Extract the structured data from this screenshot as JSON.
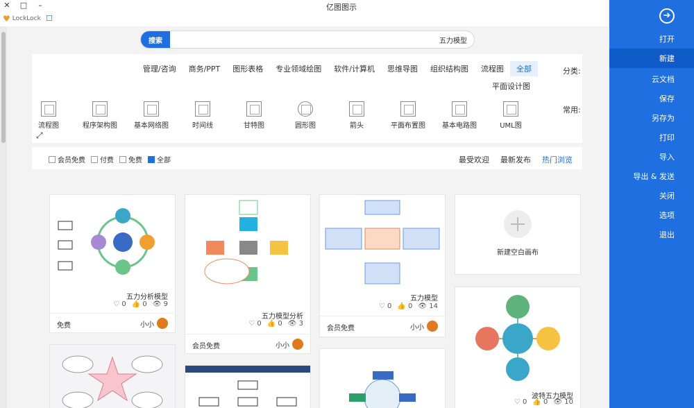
{
  "window": {
    "title": "亿图图示",
    "close": "✕",
    "max": "□",
    "min": "–"
  },
  "topbar": {
    "lock_text": "LockLock",
    "heart": "♥",
    "msg": "☐"
  },
  "search": {
    "button": "搜索",
    "value": "五力模型"
  },
  "categories": {
    "label": "分类:",
    "items": [
      "全部",
      "流程图",
      "组织结构图",
      "思维导图",
      "软件/计算机",
      "专业领域绘图",
      "图形表格",
      "商务/PPT",
      "管理/咨询"
    ],
    "row2": "平面设计图"
  },
  "common": {
    "label": "常用:",
    "items": [
      "UML图",
      "基本电路图",
      "平面布置图",
      "箭头",
      "圆形图",
      "甘特图",
      "时间线",
      "基本网络图",
      "程序架构图",
      "流程图"
    ]
  },
  "sort": {
    "tabs": [
      "热门浏览",
      "最新发布",
      "最受欢迎"
    ]
  },
  "filters": [
    "全部",
    "免费",
    "付费",
    "会员免费"
  ],
  "cards": {
    "blank": {
      "label": "新建空白画布"
    },
    "c1": {
      "title": "五力模型",
      "views": "14",
      "likes": "0",
      "favs": "0",
      "author": "小小",
      "price": "会员免费"
    },
    "c2": {
      "title": "五力模型分析",
      "views": "3",
      "likes": "0",
      "favs": "0",
      "author": "小小",
      "price": "会员免费"
    },
    "c3": {
      "title": "五力分析模型",
      "views": "9",
      "likes": "0",
      "favs": "0",
      "author": "小小",
      "price": "免费"
    },
    "c4": {
      "title": "波特五力模型",
      "views": "10",
      "likes": "0",
      "favs": "0"
    }
  },
  "sidebar": {
    "back": "➔",
    "items": [
      "打开",
      "新建",
      "云文档",
      "保存",
      "另存为",
      "打印",
      "导入",
      "导出 & 发送",
      "关闭",
      "选项",
      "退出"
    ]
  },
  "colors": {
    "accent": "#1f6fe0",
    "sidebar": "#1f6fe0"
  }
}
